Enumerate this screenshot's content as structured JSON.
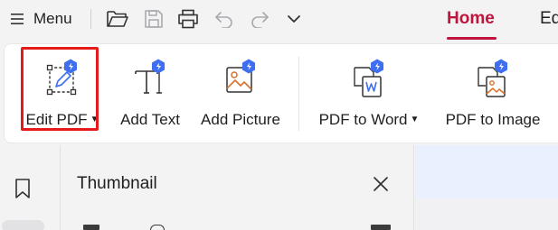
{
  "topbar": {
    "menu_label": "Menu",
    "quick_access": [
      {
        "name": "open-folder-icon"
      },
      {
        "name": "save-icon"
      },
      {
        "name": "print-icon"
      },
      {
        "name": "undo-icon"
      },
      {
        "name": "redo-icon"
      },
      {
        "name": "chevron-down-icon"
      }
    ],
    "tabs": [
      {
        "label": "Home",
        "active": true
      },
      {
        "label": "Ed",
        "active": false
      }
    ]
  },
  "ribbon": {
    "tools": [
      {
        "label": "Edit PDF",
        "icon": "edit-pdf-icon",
        "has_dropdown": true,
        "highlighted": true
      },
      {
        "label": "Add Text",
        "icon": "add-text-icon",
        "has_dropdown": false
      },
      {
        "label": "Add Picture",
        "icon": "add-picture-icon",
        "has_dropdown": false
      },
      {
        "label": "PDF to Word",
        "icon": "pdf-to-word-icon",
        "has_dropdown": true
      },
      {
        "label": "PDF to Image",
        "icon": "pdf-to-image-icon",
        "has_dropdown": false
      }
    ]
  },
  "panel": {
    "title": "Thumbnail"
  },
  "colors": {
    "accent": "#c0143c",
    "highlight_box": "#e51a1a",
    "ai_badge": "#3f6ff0",
    "icon_orange": "#d9702a"
  }
}
